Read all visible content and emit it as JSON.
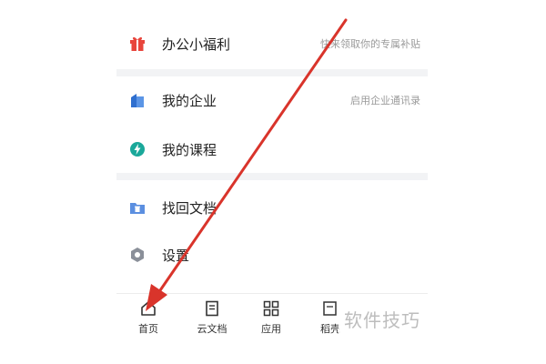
{
  "menu": {
    "welfare": {
      "label": "办公小福利",
      "hint": "快来领取你的专属补贴",
      "icon": "gift-icon",
      "icon_color": "#e8453c"
    },
    "enterprise": {
      "label": "我的企业",
      "hint": "启用企业通讯录",
      "icon": "building-icon",
      "icon_color": "#3b7bd8"
    },
    "courses": {
      "label": "我的课程",
      "icon": "lightning-icon",
      "icon_color": "#1aa89a"
    },
    "recover": {
      "label": "找回文档",
      "icon": "folder-trash-icon",
      "icon_color": "#5b8fe0"
    },
    "settings": {
      "label": "设置",
      "icon": "hexagon-gear-icon",
      "icon_color": "#8a8f99"
    }
  },
  "tabbar": {
    "tabs": [
      {
        "label": "首页",
        "icon": "home-icon"
      },
      {
        "label": "云文档",
        "icon": "document-icon"
      },
      {
        "label": "应用",
        "icon": "grid-icon"
      },
      {
        "label": "稻壳",
        "icon": "shell-icon"
      }
    ]
  },
  "annotation": {
    "arrow_color": "#d9342b"
  },
  "watermark": {
    "text": "软件技巧"
  }
}
